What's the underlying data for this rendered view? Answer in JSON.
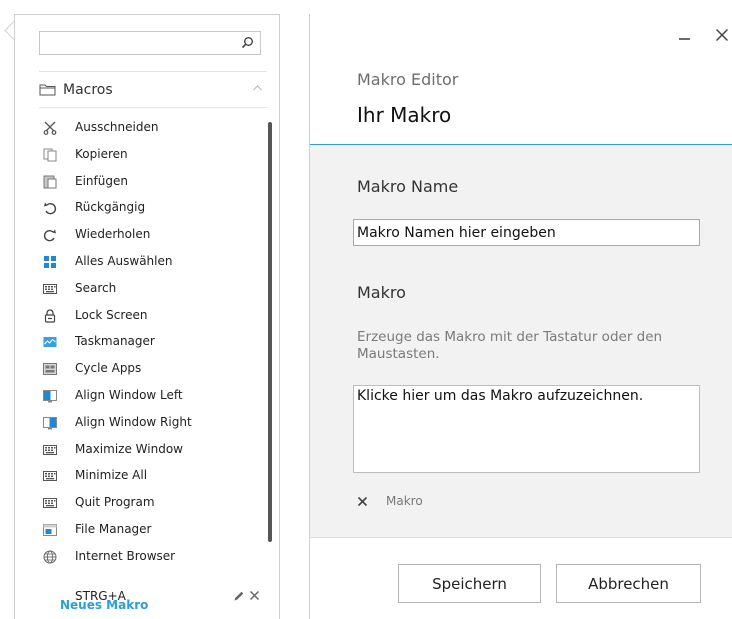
{
  "search": {
    "placeholder": ""
  },
  "section": {
    "title": "Macros"
  },
  "macros": [
    {
      "label": "Ausschneiden",
      "icon": "scissors-icon"
    },
    {
      "label": "Kopieren",
      "icon": "copy-icon"
    },
    {
      "label": "Einfügen",
      "icon": "paste-icon"
    },
    {
      "label": "Rückgängig",
      "icon": "undo-icon"
    },
    {
      "label": "Wiederholen",
      "icon": "redo-icon"
    },
    {
      "label": "Alles Auswählen",
      "icon": "select-all-icon"
    },
    {
      "label": "Search",
      "icon": "keyboard-icon"
    },
    {
      "label": "Lock Screen",
      "icon": "lock-icon"
    },
    {
      "label": "Taskmanager",
      "icon": "taskmanager-icon"
    },
    {
      "label": "Cycle Apps",
      "icon": "cycle-apps-icon"
    },
    {
      "label": "Align Window Left",
      "icon": "align-left-icon"
    },
    {
      "label": "Align Window Right",
      "icon": "align-right-icon"
    },
    {
      "label": "Maximize Window",
      "icon": "keyboard-icon"
    },
    {
      "label": "Minimize All",
      "icon": "keyboard-icon"
    },
    {
      "label": "Quit Program",
      "icon": "keyboard-icon"
    },
    {
      "label": "File Manager",
      "icon": "file-manager-icon"
    },
    {
      "label": "Internet Browser",
      "icon": "globe-icon"
    }
  ],
  "current_shortcut": {
    "label": "STRG+A"
  },
  "new_macro": {
    "label": "Neues Makro"
  },
  "editor": {
    "subtitle": "Makro Editor",
    "title": "Ihr Makro",
    "name_label": "Makro Name",
    "name_value": "Makro Namen hier eingeben",
    "macro_label": "Makro",
    "macro_hint": "Erzeuge das Makro mit der Tastatur oder den Maustasten.",
    "record_prompt": "Klicke hier um das Makro aufzuzeichnen.",
    "chip_label": "Makro",
    "save_label": "Speichern",
    "cancel_label": "Abbrechen"
  },
  "colors": {
    "accent": "#2a9fd8",
    "content_bg": "#f2f2f2"
  }
}
